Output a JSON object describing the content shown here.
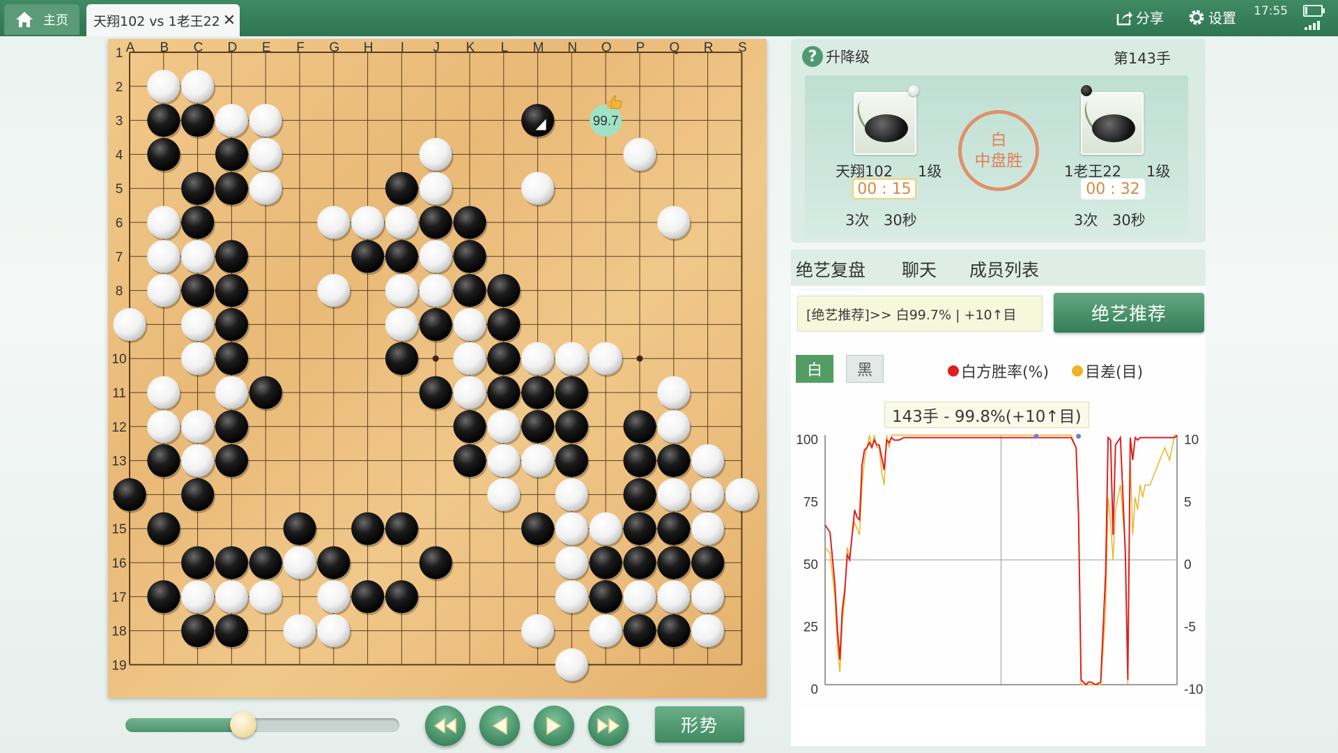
{
  "topbar": {
    "home_label": "主页",
    "game_tab_label": "天翔102 vs 1老王22",
    "close_glyph": "✕",
    "share_label": "分享",
    "settings_label": "设置",
    "clock": "17:55",
    "battery_level": 0.15,
    "signal_bars": 4
  },
  "board": {
    "size": 19,
    "col_labels": [
      "A",
      "B",
      "C",
      "D",
      "E",
      "F",
      "G",
      "H",
      "I",
      "J",
      "K",
      "L",
      "M",
      "N",
      "O",
      "P",
      "Q",
      "R",
      "S"
    ],
    "row_labels": [
      "1",
      "2",
      "3",
      "4",
      "5",
      "6",
      "7",
      "8",
      "9",
      "10",
      "11",
      "12",
      "13",
      "14",
      "15",
      "16",
      "17",
      "18",
      "19"
    ],
    "star_points": [
      [
        3,
        3
      ],
      [
        9,
        3
      ],
      [
        15,
        3
      ],
      [
        3,
        9
      ],
      [
        9,
        9
      ],
      [
        15,
        9
      ],
      [
        3,
        15
      ],
      [
        9,
        15
      ],
      [
        15,
        15
      ]
    ],
    "black_stones": [
      [
        1,
        3
      ],
      [
        2,
        3
      ],
      [
        1,
        4
      ],
      [
        3,
        4
      ],
      [
        2,
        5
      ],
      [
        3,
        5
      ],
      [
        8,
        5
      ],
      [
        2,
        6
      ],
      [
        9,
        6
      ],
      [
        10,
        6
      ],
      [
        3,
        7
      ],
      [
        7,
        7
      ],
      [
        8,
        7
      ],
      [
        10,
        7
      ],
      [
        2,
        8
      ],
      [
        3,
        8
      ],
      [
        10,
        8
      ],
      [
        11,
        8
      ],
      [
        3,
        9
      ],
      [
        9,
        9
      ],
      [
        11,
        9
      ],
      [
        3,
        10
      ],
      [
        8,
        10
      ],
      [
        11,
        10
      ],
      [
        4,
        11
      ],
      [
        9,
        11
      ],
      [
        11,
        11
      ],
      [
        12,
        11
      ],
      [
        13,
        11
      ],
      [
        3,
        12
      ],
      [
        10,
        12
      ],
      [
        12,
        12
      ],
      [
        13,
        12
      ],
      [
        15,
        12
      ],
      [
        1,
        13
      ],
      [
        3,
        13
      ],
      [
        10,
        13
      ],
      [
        13,
        13
      ],
      [
        15,
        13
      ],
      [
        16,
        13
      ],
      [
        0,
        14
      ],
      [
        2,
        14
      ],
      [
        15,
        14
      ],
      [
        1,
        15
      ],
      [
        5,
        15
      ],
      [
        7,
        15
      ],
      [
        8,
        15
      ],
      [
        12,
        15
      ],
      [
        15,
        15
      ],
      [
        16,
        15
      ],
      [
        2,
        16
      ],
      [
        3,
        16
      ],
      [
        4,
        16
      ],
      [
        6,
        16
      ],
      [
        9,
        16
      ],
      [
        14,
        16
      ],
      [
        15,
        16
      ],
      [
        16,
        16
      ],
      [
        17,
        16
      ],
      [
        1,
        17
      ],
      [
        7,
        17
      ],
      [
        8,
        17
      ],
      [
        14,
        17
      ],
      [
        2,
        18
      ],
      [
        3,
        18
      ],
      [
        15,
        18
      ],
      [
        16,
        18
      ],
      [
        12,
        3
      ]
    ],
    "white_stones": [
      [
        1,
        2
      ],
      [
        2,
        2
      ],
      [
        3,
        3
      ],
      [
        4,
        3
      ],
      [
        4,
        4
      ],
      [
        9,
        4
      ],
      [
        15,
        4
      ],
      [
        4,
        5
      ],
      [
        9,
        5
      ],
      [
        12,
        5
      ],
      [
        1,
        6
      ],
      [
        6,
        6
      ],
      [
        7,
        6
      ],
      [
        8,
        6
      ],
      [
        16,
        6
      ],
      [
        1,
        7
      ],
      [
        2,
        7
      ],
      [
        9,
        7
      ],
      [
        1,
        8
      ],
      [
        6,
        8
      ],
      [
        8,
        8
      ],
      [
        9,
        8
      ],
      [
        0,
        9
      ],
      [
        2,
        9
      ],
      [
        8,
        9
      ],
      [
        10,
        9
      ],
      [
        2,
        10
      ],
      [
        10,
        10
      ],
      [
        12,
        10
      ],
      [
        13,
        10
      ],
      [
        14,
        10
      ],
      [
        1,
        11
      ],
      [
        3,
        11
      ],
      [
        10,
        11
      ],
      [
        16,
        11
      ],
      [
        1,
        12
      ],
      [
        2,
        12
      ],
      [
        11,
        12
      ],
      [
        16,
        12
      ],
      [
        2,
        13
      ],
      [
        11,
        13
      ],
      [
        12,
        13
      ],
      [
        17,
        13
      ],
      [
        11,
        14
      ],
      [
        13,
        14
      ],
      [
        16,
        14
      ],
      [
        17,
        14
      ],
      [
        18,
        14
      ],
      [
        13,
        15
      ],
      [
        14,
        15
      ],
      [
        17,
        15
      ],
      [
        5,
        16
      ],
      [
        13,
        16
      ],
      [
        2,
        17
      ],
      [
        3,
        17
      ],
      [
        4,
        17
      ],
      [
        6,
        17
      ],
      [
        13,
        17
      ],
      [
        15,
        17
      ],
      [
        16,
        17
      ],
      [
        17,
        17
      ],
      [
        5,
        18
      ],
      [
        6,
        18
      ],
      [
        12,
        18
      ],
      [
        14,
        18
      ],
      [
        17,
        18
      ],
      [
        13,
        19
      ]
    ],
    "last_move": [
      12,
      3
    ],
    "recommend_point": [
      14,
      3
    ],
    "recommend_value": "99.7"
  },
  "controls": {
    "progress": 0.43,
    "shape_label": "形势"
  },
  "info": {
    "help_label": "升降级",
    "move_no": "第143手",
    "player1": {
      "name": "天翔102",
      "level": "1级",
      "time": "00 : 15",
      "byoyomi": "3次 30秒"
    },
    "player2": {
      "name": "1老王22",
      "level": "1级",
      "time": "00 : 32",
      "byoyomi": "3次 30秒"
    },
    "result_line1": "白",
    "result_line2": "中盘胜"
  },
  "tabs": [
    "绝艺复盘",
    "聊天",
    "成员列表"
  ],
  "review": {
    "recommend_text": "[绝艺推荐]>> 白99.7% | +10↑目",
    "recommend_button": "绝艺推荐",
    "white_button": "白",
    "black_button": "黑",
    "legend_winrate": "白方胜率(%)",
    "legend_diff": "目差(目)",
    "tooltip": "143手 - 99.8%(+10↑目)"
  },
  "chart_data": {
    "type": "line",
    "x_range": [
      0,
      143
    ],
    "y_left_ticks": [
      "100",
      "75",
      "50",
      "25",
      "0"
    ],
    "y_right_ticks": [
      "10",
      "5",
      "0",
      "-5",
      "-10"
    ],
    "ylim_left": [
      0,
      100
    ],
    "ylim_right": [
      -10,
      10
    ],
    "marker_x": 143,
    "colors": {
      "winrate": "#e01818",
      "diff": "#f0b020",
      "border": "#777777"
    },
    "series": [
      {
        "name": "白方胜率(%)",
        "x": [
          0,
          2,
          4,
          5,
          6,
          7,
          8,
          9,
          10,
          11,
          12,
          13,
          14,
          15,
          16,
          17,
          18,
          19,
          20,
          21,
          22,
          23,
          24,
          25,
          26,
          27,
          28,
          29,
          30,
          32,
          35,
          40,
          45,
          50,
          55,
          60,
          65,
          70,
          75,
          80,
          85,
          90,
          95,
          100,
          102,
          103,
          104,
          105,
          106,
          107,
          108,
          110,
          112,
          114,
          115,
          116,
          117,
          118,
          120,
          122,
          123,
          124,
          125,
          126,
          127,
          128,
          129,
          130,
          132,
          134,
          136,
          138,
          140,
          142,
          143
        ],
        "values": [
          64,
          61,
          40,
          22,
          10,
          30,
          38,
          52,
          50,
          60,
          70,
          67,
          66,
          88,
          94,
          95,
          97,
          95,
          98,
          96,
          96,
          91,
          86,
          98,
          97,
          99,
          98,
          98,
          98,
          99,
          99,
          99,
          99,
          99,
          99,
          99,
          99,
          99,
          99,
          99,
          99,
          99,
          99,
          99,
          95,
          68,
          2,
          1,
          0,
          1,
          1,
          0,
          1,
          45,
          99,
          98,
          60,
          96,
          99,
          53,
          2,
          99,
          90,
          99,
          98,
          99,
          99,
          99,
          99,
          99,
          99,
          99,
          99,
          99,
          99.8
        ]
      },
      {
        "name": "目差(目)",
        "x": [
          0,
          2,
          4,
          5,
          6,
          7,
          8,
          9,
          10,
          11,
          12,
          13,
          14,
          15,
          16,
          17,
          18,
          19,
          20,
          21,
          22,
          23,
          24,
          25,
          26,
          27,
          28,
          29,
          30,
          32,
          35,
          40,
          45,
          50,
          55,
          60,
          65,
          70,
          75,
          80,
          85,
          90,
          95,
          100,
          102,
          103,
          104,
          105,
          106,
          107,
          108,
          110,
          112,
          114,
          115,
          116,
          117,
          118,
          120,
          122,
          123,
          124,
          125,
          126,
          127,
          128,
          129,
          130,
          132,
          134,
          136,
          138,
          140,
          142,
          143
        ],
        "values": [
          1,
          0.5,
          -3,
          -7,
          -9,
          -5,
          -3,
          1,
          0.2,
          2,
          3,
          2.5,
          2,
          6,
          8,
          9,
          10,
          9,
          10,
          9,
          9,
          7,
          6,
          10,
          9,
          10,
          10,
          10,
          10,
          10,
          10,
          10,
          10,
          10,
          10,
          10,
          10,
          10,
          10,
          10,
          10,
          10,
          10,
          10,
          9,
          3,
          -10,
          -10,
          -10,
          -10,
          -10,
          -10,
          -10,
          -4,
          5,
          3,
          0,
          4,
          6,
          1,
          -10,
          8,
          2,
          5,
          4,
          6,
          5,
          6,
          6,
          7,
          8,
          9,
          8,
          10,
          10
        ]
      }
    ]
  }
}
